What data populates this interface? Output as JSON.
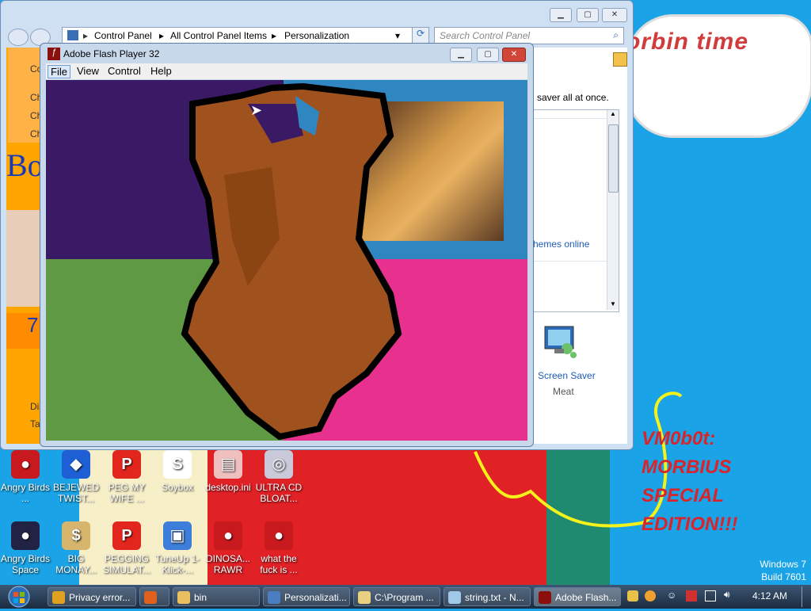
{
  "wallpaper": {
    "bubble_text": "orbin time",
    "vm_text": [
      "VM0b0t:",
      "MORBIUS",
      "SPECIAL",
      "EDITION!!!"
    ],
    "watermark": [
      "Windows 7",
      "Build 7601"
    ]
  },
  "control_panel": {
    "breadcrumb": [
      "Control Panel",
      "All Control Panel Items",
      "Personalization"
    ],
    "search_placeholder": "Search Control Panel",
    "text_saver": "saver all at once.",
    "themes_online": "hemes online",
    "screen_saver_label": "Screen Saver",
    "screen_saver_value": "Meat",
    "left_fragments": [
      "Co",
      "Ch",
      "Ch",
      "Ch",
      "Bo",
      "7",
      "Dis",
      "Ta"
    ]
  },
  "flash": {
    "title": "Adobe Flash Player 32",
    "menu": [
      "File",
      "View",
      "Control",
      "Help"
    ]
  },
  "desktop_icons": [
    {
      "label": "Angry Birds ...",
      "color": "#c8191e",
      "glyph": "●"
    },
    {
      "label": "BEJEWED TWIST...",
      "color": "#1f5fd6",
      "glyph": "◆"
    },
    {
      "label": "PEG MY WIFE ...",
      "color": "#e2261d",
      "glyph": "P"
    },
    {
      "label": "Soybox",
      "color": "#ffffff",
      "glyph": "S"
    },
    {
      "label": "desktop.ini",
      "color": "#f0c0c0",
      "glyph": "▤"
    },
    {
      "label": "ULTRA CD BLOAT...",
      "color": "#c9c9d9",
      "glyph": "◎"
    },
    {
      "label": "Angry Birds Space",
      "color": "#222244",
      "glyph": "●"
    },
    {
      "label": "BIG MONAY...",
      "color": "#d7b56d",
      "glyph": "$"
    },
    {
      "label": "PEGGING SIMULAT...",
      "color": "#e2261d",
      "glyph": "P"
    },
    {
      "label": "TuneUp 1-Klick-...",
      "color": "#3d7edb",
      "glyph": "▣"
    },
    {
      "label": "DINOSA... RAWR",
      "color": "#c8191e",
      "glyph": "●"
    },
    {
      "label": "what the fuck is ...",
      "color": "#c8191e",
      "glyph": "●"
    }
  ],
  "taskbar": {
    "items": [
      {
        "label": "Privacy error...",
        "color": "#e0a020"
      },
      {
        "label": "",
        "color": "#e06020"
      },
      {
        "label": "bin",
        "color": "#e8c060"
      },
      {
        "label": "Personalizati...",
        "color": "#4a7ec0"
      },
      {
        "label": "C:\\Program ...",
        "color": "#e8d080"
      },
      {
        "label": "string.txt - N...",
        "color": "#a0c8e8"
      },
      {
        "label": "Adobe Flash...",
        "color": "#8a1010"
      }
    ],
    "clock": "4:12 AM"
  }
}
